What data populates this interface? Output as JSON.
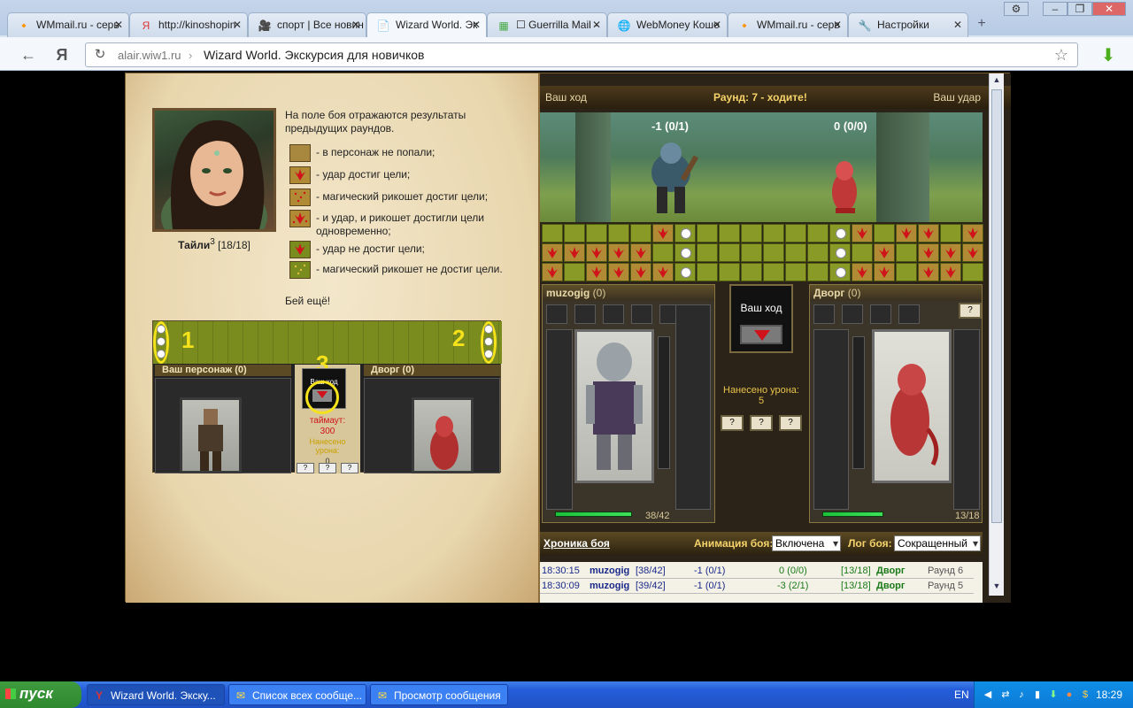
{
  "browser": {
    "tabs": [
      {
        "label": "WMmail.ru - серв",
        "icon": "🔸"
      },
      {
        "label": "http://kinoshopin",
        "icon": "Я"
      },
      {
        "label": "спорт | Все новин",
        "icon": "🎥"
      },
      {
        "label": "Wizard World. Эк",
        "icon": "📄"
      },
      {
        "label": "☐ Guerrilla Mail -",
        "icon": "▦"
      },
      {
        "label": "WebMoney Коше",
        "icon": "🌐"
      },
      {
        "label": "WMmail.ru - серв",
        "icon": "🔸"
      },
      {
        "label": "Настройки",
        "icon": "🔧"
      }
    ],
    "active_tab": 3,
    "url_host": "alair.wiw1.ru",
    "url_sep": "›",
    "page_title": "Wizard World. Экскурсия для новичков",
    "back_glyph": "←",
    "ya_glyph": "Я",
    "reload_glyph": "↻"
  },
  "tutorial": {
    "char_name": "Тайли",
    "char_level": "3",
    "char_hp": "[18/18]",
    "intro": "На поле боя отражаются результаты предыдущих раундов.",
    "legend": [
      "- в персонаж не попали;",
      "- удар достиг цели;",
      "- магический рикошет достиг цели;",
      "- и удар, и рикошет достигли цели одновременно;",
      "- удар не достиг цели;",
      "- магический рикошет не достиг цели."
    ],
    "again": "Бей ещё!",
    "mini": {
      "num1": "1",
      "num2": "2",
      "num3": "3",
      "your_char": "Ваш персонаж",
      "your_char_count": "(0)",
      "enemy": "Дворг",
      "enemy_count": "(0)",
      "your_turn": "Ваш ход",
      "timeout_label": "таймаут:",
      "timeout_val": "300",
      "damage_label": "Нанесено урона:",
      "damage_val": "0"
    }
  },
  "battle": {
    "top_left": "Ваш ход",
    "top_center": "Раунд: 7 - ходите!",
    "top_right": "Ваш удар",
    "hp_left": "-1 (0/1)",
    "hp_right": "0 (0/0)",
    "player": {
      "name": "muzogig",
      "count": "(0)",
      "hp": "38/42",
      "hp_frac": 0.905
    },
    "enemy": {
      "name": "Дворг",
      "count": "(0)",
      "hp": "13/18",
      "hp_frac": 0.72
    },
    "your_turn": "Ваш ход",
    "damage_label": "Нанесено урона:",
    "damage_val": "5",
    "scroll_btn": "?",
    "chronicle": "Хроника боя",
    "anim_label": "Анимация боя:",
    "anim_value": "Включена",
    "log_label": "Лог боя:",
    "log_value": "Сокращенный",
    "log_rows": [
      {
        "time": "18:30:15",
        "name": "muzogig",
        "hp": "[38/42]",
        "hit": "-1 (0/1)",
        "res": "0 (0/0)",
        "ehp": "[13/18]",
        "ename": "Дворг",
        "round": "Раунд 6"
      },
      {
        "time": "18:30:09",
        "name": "muzogig",
        "hp": "[39/42]",
        "hit": "-1 (0/1)",
        "res": "-3 (2/1)",
        "ehp": "[13/18]",
        "ename": "Дворг",
        "round": "Раунд 5"
      }
    ]
  },
  "taskbar": {
    "start": "пуск",
    "tasks": [
      {
        "label": "Wizard World. Экску...",
        "icon": "Y"
      },
      {
        "label": "Список всех сообще...",
        "icon": "✉"
      },
      {
        "label": "Просмотр сообщения",
        "icon": "✉"
      }
    ],
    "lang": "EN",
    "clock": "18:29"
  },
  "colors": {
    "accent": "#f5d36a",
    "hit": "#d0121a",
    "tray": "#0c7bd8"
  }
}
